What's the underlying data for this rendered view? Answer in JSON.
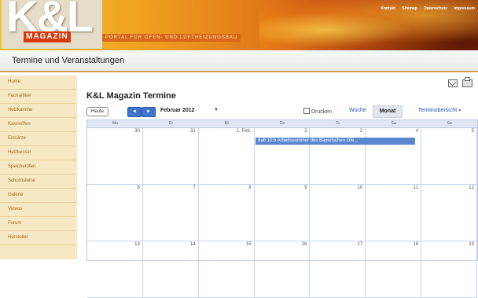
{
  "header": {
    "logo_main": "K&L",
    "logo_sub": "MAGAZIN",
    "tagline": "PORTAL FÜR OFEN- UND LUFTHEIZUNGSBAU",
    "top_nav": [
      "Kontakt",
      "Sitemap",
      "Datenschutz",
      "Impressum"
    ]
  },
  "title_bar": {
    "text": "Termine und Veranstaltungen"
  },
  "sidebar": {
    "items": [
      "Home",
      "Fachartikel",
      "Heizkamine",
      "Kaminöfen",
      "Einsätze",
      "Heizkessel",
      "Speicheröfen",
      "Schornsteine",
      "Galerie",
      "Videos",
      "Forum",
      "Hersteller"
    ]
  },
  "calendar": {
    "title": "K&L Magazin Termine",
    "today_label": "Heute",
    "prev_label": "◄",
    "next_label": "►",
    "month_label": "Februar 2012",
    "month_caret": "▼",
    "print_label": "Drucken",
    "tabs": [
      "Woche",
      "Monat",
      "Terminübersicht"
    ],
    "active_tab": "Monat",
    "weekdays": [
      "Mo",
      "Di",
      "Mi",
      "Do",
      "Fr",
      "Sa",
      "So"
    ],
    "weeks": [
      [
        "30",
        "31",
        "1. Feb.",
        "2",
        "3",
        "4",
        "5"
      ],
      [
        "6",
        "7",
        "8",
        "9",
        "10",
        "11",
        "12"
      ],
      [
        "13",
        "14",
        "15",
        "16",
        "17",
        "18",
        "19"
      ]
    ],
    "event": {
      "text": "8ab 10:h Arbeitssommer des Bayerischen Ofe..."
    }
  },
  "colors": {
    "accent_blue": "#3f74cf",
    "event_blue": "#5b87d1",
    "sidebar_bg": "#f7e8c4",
    "header_orange": "#e07818"
  },
  "icons": [
    "mail-icon",
    "print-icon",
    "print-small-icon",
    "arrow-left-icon",
    "arrow-right-icon",
    "chevron-down-icon"
  ]
}
